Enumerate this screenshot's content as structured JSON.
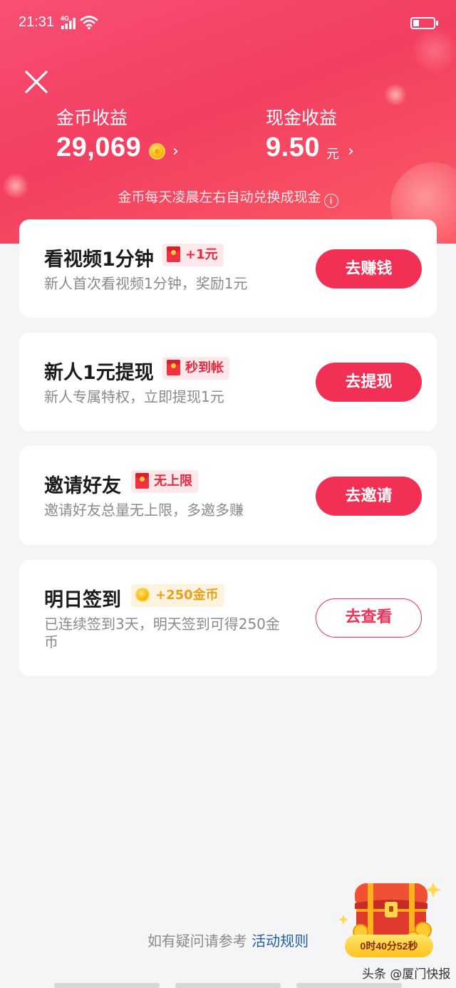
{
  "status_bar": {
    "time": "21:31",
    "network": "4G"
  },
  "header": {
    "coin_earnings": {
      "label": "金币收益",
      "value": "29,069"
    },
    "cash_earnings": {
      "label": "现金收益",
      "value": "9.50",
      "unit": "元"
    },
    "hint": "金币每天凌晨左右自动兑换成现金"
  },
  "tasks": [
    {
      "title": "看视频1分钟",
      "badge": "+1元",
      "desc": "新人首次看视频1分钟，奖励1元",
      "button": "去赚钱"
    },
    {
      "title": "新人1元提现",
      "badge": "秒到帐",
      "desc": "新人专属特权，立即提现1元",
      "button": "去提现"
    },
    {
      "title": "邀请好友",
      "badge": "无上限",
      "desc": "邀请好友总量无上限，多邀多赚",
      "button": "去邀请"
    },
    {
      "title": "明日签到",
      "badge": "+250金币",
      "desc_line1": "已连续签到3天，明天签到可得250金",
      "desc_line2": "币",
      "button": "去查看"
    }
  ],
  "footer": {
    "text": "如有疑问请参考",
    "link": "活动规则"
  },
  "treasure": {
    "timer": "0时40分52秒"
  },
  "watermark": "头条 @厦门快报",
  "colors": {
    "accent": "#f22f55",
    "header_bg": "#f43f63",
    "link": "#1f5fa6"
  }
}
